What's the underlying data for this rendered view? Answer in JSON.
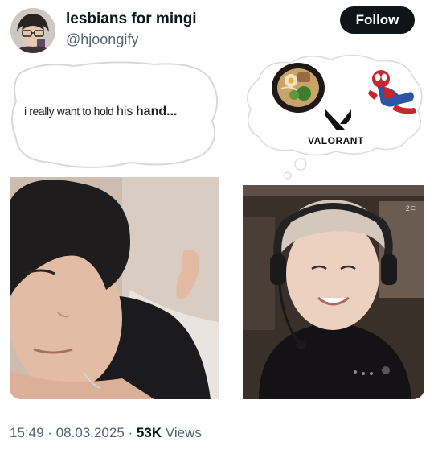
{
  "tweet": {
    "display_name": "lesbians for mingi",
    "handle": "@hjoongify",
    "follow_label": "Follow"
  },
  "media": {
    "thought_text": "i really want to hold",
    "thought_his": "his",
    "thought_hand": "hand...",
    "valorant_label": "VALORANT",
    "stream_corner_text": "2ㅌ"
  },
  "meta": {
    "time": "15:49",
    "sep1": "·",
    "date": "08.03.2025",
    "sep2": "·",
    "views_count": "53K",
    "views_label": "Views"
  },
  "colors": {
    "follow_bg": "#0f1419",
    "secondary_text": "#536471"
  }
}
